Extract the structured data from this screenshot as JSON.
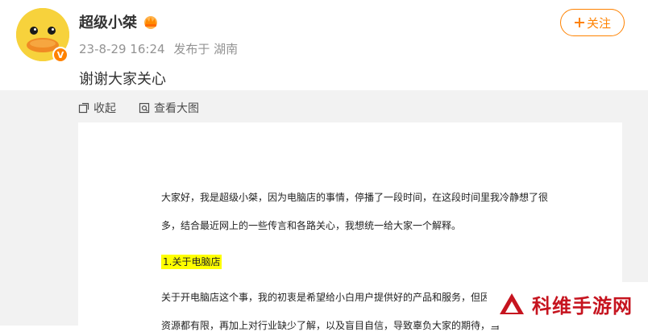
{
  "author": {
    "name": "超级小桀",
    "avatar_icon": "yellow-duck-avatar",
    "badge_icon": "verified-v-badge",
    "crown_icon": "crown-icon"
  },
  "meta": {
    "timestamp": "23-8-29 16:24",
    "location": "发布于 湖南"
  },
  "follow": {
    "label": "关注",
    "icon": "plus-icon"
  },
  "post": {
    "text": "谢谢大家关心"
  },
  "toolbar": {
    "collapse_label": "收起",
    "view_large_label": "查看大图"
  },
  "document": {
    "lines": [
      "大家好，我是超级小桀，因为电脑店的事情，停播了一段时间，在这段时间里我冷静想了很",
      "多，结合最近网上的一些传言和各路关心，我想统一给大家一个解释。",
      "1.关于电脑店",
      "关于开电脑店这个事，我的初衷是希望给小白用户提供好的产品和服务，但因为",
      "资源都有限，再加上对行业缺少了解，以及盲目自信，导致辜负大家的期待，当"
    ]
  },
  "watermark": {
    "text": "科维手游网"
  },
  "colors": {
    "accent": "#ff8200",
    "meta_gray": "#939393",
    "panel_bg": "#f2f2f2",
    "highlight": "#ffff00",
    "watermark_red": "#c6141f"
  }
}
